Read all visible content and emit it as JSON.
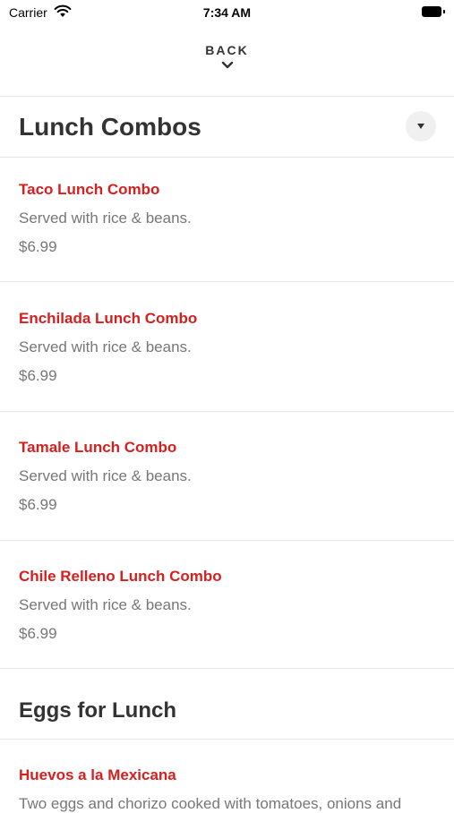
{
  "status": {
    "carrier": "Carrier",
    "time": "7:34 AM"
  },
  "nav": {
    "back_label": "BACK"
  },
  "sections": [
    {
      "title": "Lunch Combos",
      "items": [
        {
          "name": "Taco Lunch Combo",
          "description": "Served with rice & beans.",
          "price": "$6.99"
        },
        {
          "name": "Enchilada Lunch Combo",
          "description": "Served with rice & beans.",
          "price": "$6.99"
        },
        {
          "name": "Tamale Lunch Combo",
          "description": "Served with rice & beans.",
          "price": "$6.99"
        },
        {
          "name": "Chile Relleno Lunch Combo",
          "description": "Served with rice & beans.",
          "price": "$6.99"
        }
      ]
    },
    {
      "title": "Eggs for Lunch",
      "items": [
        {
          "name": "Huevos a la Mexicana",
          "description": "Two eggs and chorizo cooked with tomatoes, onions and"
        }
      ]
    }
  ],
  "colors": {
    "item_name": "#d61f1f",
    "text_muted": "#777777",
    "heading": "#333333",
    "divider": "#e6e6e6"
  }
}
